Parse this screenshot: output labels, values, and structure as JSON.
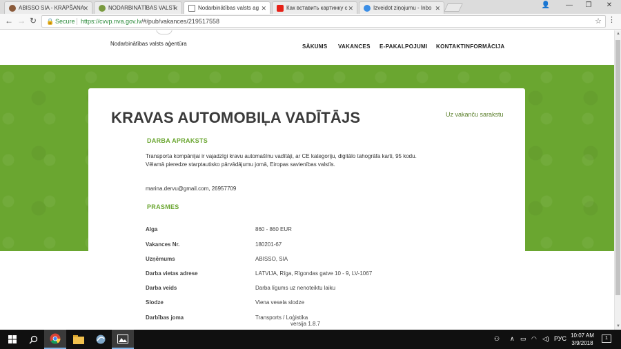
{
  "browser": {
    "tabs": [
      {
        "title": "ABISSO SIA - KRĀPŠANA",
        "favicon_color": "#8a5a3a"
      },
      {
        "title": "NODARBINĀTĪBAS VALST",
        "favicon_color": "#7a9a40"
      },
      {
        "title": "Nodarbinātības valsts ag",
        "favicon_color": "#ffffff",
        "active": true
      },
      {
        "title": "Как вставить картинку с",
        "favicon_color": "#e62117"
      },
      {
        "title": "Izveidot ziņojumu - Inbo",
        "favicon_color": "#3b8ee6"
      }
    ],
    "tab_close": "✕",
    "window_controls": {
      "profile": "👤",
      "minimize": "—",
      "maximize": "❐",
      "close": "✕"
    },
    "address": {
      "secure_label": "Secure",
      "url_host": "https://cvvp.nva.gov.lv",
      "url_path": "/#/pub/vakances/219517558"
    }
  },
  "site": {
    "logo_text": "Nodarbinātības valsts aģentūra",
    "nav": [
      "SĀKUMS",
      "VAKANCES",
      "E-PAKALPOJUMI",
      "KONTAKTINFORMĀCIJA"
    ]
  },
  "job": {
    "title": "KRAVAS AUTOMOBIĻA VADĪTĀJS",
    "back_link": "Uz vakanču sarakstu",
    "description_heading": "DARBA APRAKSTS",
    "description_lines": [
      "Transporta kompānijai ir vajadzīgi kravu automašīnu vadītāji, ar CE kategoriju, digitālo tahogrāfa karti, 95 kodu.",
      "Vēlamā pieredze starptautisko pārvādājumu jomā, Eiropas savienības valstīs."
    ],
    "contact": "marina.dervu@gmail.com, 26957709",
    "requirements_heading": "PRASMES",
    "details": [
      {
        "label": "Alga",
        "value": "860 - 860 EUR"
      },
      {
        "label": "Vakances Nr.",
        "value": "180201-67"
      },
      {
        "label": "Uzņēmums",
        "value": "ABISSO, SIA"
      },
      {
        "label": "Darba vietas adrese",
        "value": "LATVIJA, Rīga, Rīgondas gatve 10 - 9, LV-1067"
      },
      {
        "label": "Darba veids",
        "value": "Darba līgums uz nenoteiktu laiku"
      },
      {
        "label": "Slodze",
        "value": "Viena vesela slodze"
      },
      {
        "label": "Darbības joma",
        "value": "Transports / Loģistika"
      }
    ],
    "version": "versija 1.8.7"
  },
  "taskbar": {
    "language": "РУС",
    "time": "10:07 AM",
    "date": "3/9/2018",
    "notifications": "1"
  },
  "colors": {
    "accent_green": "#6aa630",
    "link_green": "#5a7f2a",
    "secure_green": "#2a8a3a"
  }
}
